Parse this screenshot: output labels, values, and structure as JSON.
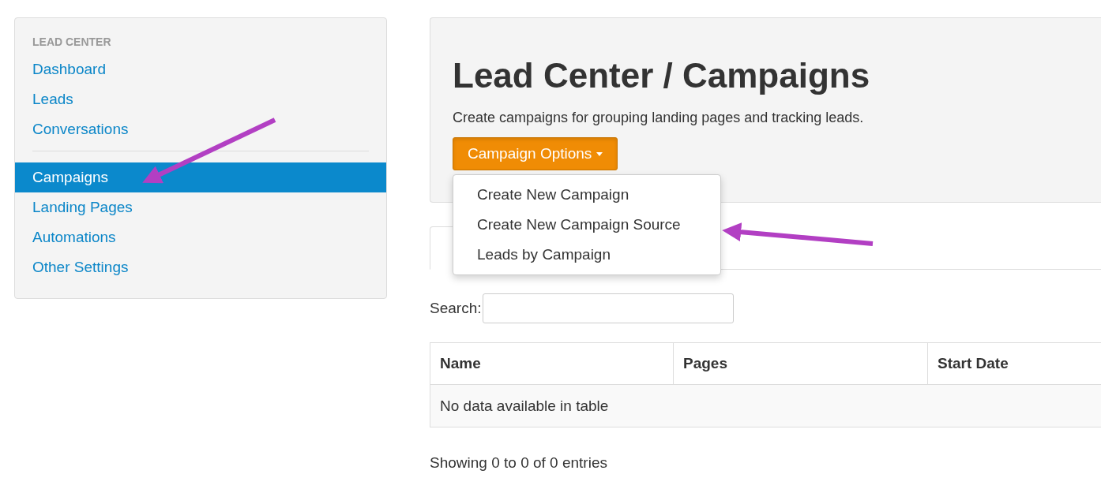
{
  "sidebar": {
    "heading": "LEAD CENTER",
    "items": [
      {
        "label": "Dashboard",
        "selected": false,
        "kind": "link"
      },
      {
        "label": "Leads",
        "selected": false,
        "kind": "link"
      },
      {
        "label": "Conversations",
        "selected": false,
        "kind": "link"
      },
      {
        "kind": "divider"
      },
      {
        "label": "Campaigns",
        "selected": true,
        "kind": "link"
      },
      {
        "label": "Landing Pages",
        "selected": false,
        "kind": "link"
      },
      {
        "label": "Automations",
        "selected": false,
        "kind": "link"
      },
      {
        "label": "Other Settings",
        "selected": false,
        "kind": "link"
      }
    ]
  },
  "header": {
    "title": "Lead Center / Campaigns",
    "description": "Create campaigns for grouping landing pages and tracking leads.",
    "button": "Campaign Options"
  },
  "dropdown": {
    "expanded": true,
    "items": [
      "Create New Campaign",
      "Create New Campaign Source",
      "Leads by Campaign"
    ]
  },
  "search": {
    "label": "Search:"
  },
  "table": {
    "columns": [
      "Name",
      "Pages",
      "Start Date"
    ],
    "empty_message": "No data available in table"
  },
  "footer": "Showing 0 to 0 of 0 entries"
}
